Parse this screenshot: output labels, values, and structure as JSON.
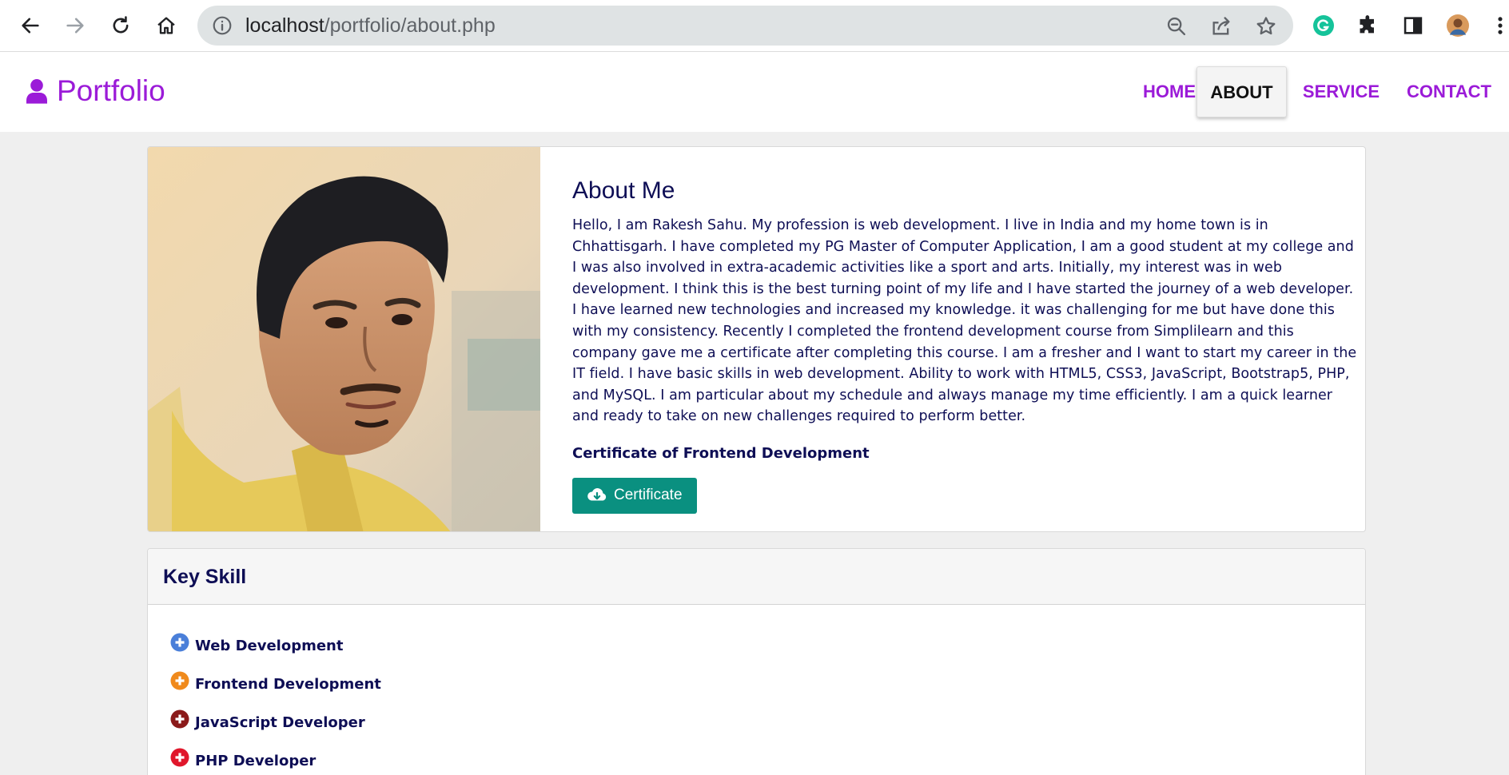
{
  "browser": {
    "url_host": "localhost",
    "url_path": "/portfolio/about.php"
  },
  "site": {
    "brand": "Portfolio",
    "nav": [
      {
        "label": "HOME"
      },
      {
        "label": "ABOUT",
        "active": true
      },
      {
        "label": "SERVICE"
      },
      {
        "label": "CONTACT"
      }
    ]
  },
  "about": {
    "title": "About Me",
    "paragraph": "Hello, I am Rakesh Sahu. My profession is web development. I live in India and my home town is in Chhattisgarh. I have completed my PG Master of Computer Application, I am a good student at my college and I was also involved in extra-academic activities like a sport and arts. Initially, my interest was in web development. I think this is the best turning point of my life and I have started the journey of a web developer. I have learned new technologies and increased my knowledge. it was challenging for me but have done this with my consistency. Recently I completed the frontend development course from Simplilearn and this company gave me a certificate after completing this course. I am a fresher and I want to start my career in the IT field. I have basic skills in web development. Ability to work with HTML5, CSS3, JavaScript, Bootstrap5, PHP, and MySQL. I am particular about my schedule and always manage my time efficiently. I am a quick learner and ready to take on new challenges required to perform better.",
    "certificate_heading": "Certificate of Frontend Development",
    "certificate_button": "Certificate"
  },
  "skills": {
    "title": "Key Skill",
    "items": [
      {
        "label": "Web Development",
        "color": "#4a7fd9"
      },
      {
        "label": "Frontend Development",
        "color": "#f08a1c"
      },
      {
        "label": "JavaScript Developer",
        "color": "#8b1a1a"
      },
      {
        "label": "PHP Developer",
        "color": "#e0162b"
      }
    ]
  },
  "colors": {
    "brand": "#9b1bd8",
    "navy": "#0e0e55",
    "teal": "#0a9080"
  }
}
